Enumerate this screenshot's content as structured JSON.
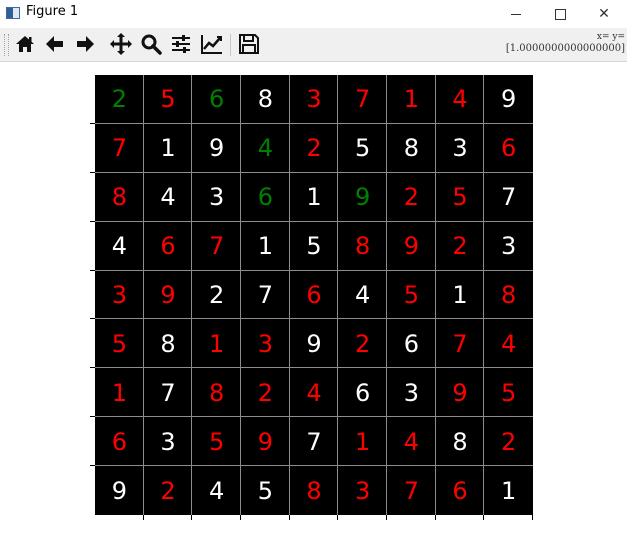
{
  "window": {
    "title": "Figure 1",
    "minimize_glyph": "",
    "maximize_glyph": "",
    "close_glyph": "✕"
  },
  "toolbar": {
    "buttons": [
      {
        "name": "home-button",
        "icon": "home-icon"
      },
      {
        "name": "back-button",
        "icon": "arrow-left-icon"
      },
      {
        "name": "forward-button",
        "icon": "arrow-right-icon"
      },
      {
        "name": "pan-button",
        "icon": "move-icon"
      },
      {
        "name": "zoom-button",
        "icon": "magnifier-icon"
      },
      {
        "name": "configure-subplots-button",
        "icon": "sliders-icon"
      },
      {
        "name": "edit-axes-button",
        "icon": "line-chart-icon"
      },
      {
        "name": "save-button",
        "icon": "floppy-disk-icon"
      }
    ],
    "coords_line1": "x= y=",
    "coords_line2": "[1.0000000000000000]"
  },
  "colors": {
    "board_background": "#000000",
    "grid": "#8c8c8c",
    "white": "#ffffff",
    "red": "#ff0000",
    "green": "#008000"
  },
  "board": {
    "rows": [
      [
        {
          "v": "2",
          "c": "green"
        },
        {
          "v": "5",
          "c": "red"
        },
        {
          "v": "6",
          "c": "green"
        },
        {
          "v": "8",
          "c": "white"
        },
        {
          "v": "3",
          "c": "red"
        },
        {
          "v": "7",
          "c": "red"
        },
        {
          "v": "1",
          "c": "red"
        },
        {
          "v": "4",
          "c": "red"
        },
        {
          "v": "9",
          "c": "white"
        }
      ],
      [
        {
          "v": "7",
          "c": "red"
        },
        {
          "v": "1",
          "c": "white"
        },
        {
          "v": "9",
          "c": "white"
        },
        {
          "v": "4",
          "c": "green"
        },
        {
          "v": "2",
          "c": "red"
        },
        {
          "v": "5",
          "c": "white"
        },
        {
          "v": "8",
          "c": "white"
        },
        {
          "v": "3",
          "c": "white"
        },
        {
          "v": "6",
          "c": "red"
        }
      ],
      [
        {
          "v": "8",
          "c": "red"
        },
        {
          "v": "4",
          "c": "white"
        },
        {
          "v": "3",
          "c": "white"
        },
        {
          "v": "6",
          "c": "green"
        },
        {
          "v": "1",
          "c": "white"
        },
        {
          "v": "9",
          "c": "green"
        },
        {
          "v": "2",
          "c": "red"
        },
        {
          "v": "5",
          "c": "red"
        },
        {
          "v": "7",
          "c": "white"
        }
      ],
      [
        {
          "v": "4",
          "c": "white"
        },
        {
          "v": "6",
          "c": "red"
        },
        {
          "v": "7",
          "c": "red"
        },
        {
          "v": "1",
          "c": "white"
        },
        {
          "v": "5",
          "c": "white"
        },
        {
          "v": "8",
          "c": "red"
        },
        {
          "v": "9",
          "c": "red"
        },
        {
          "v": "2",
          "c": "red"
        },
        {
          "v": "3",
          "c": "white"
        }
      ],
      [
        {
          "v": "3",
          "c": "red"
        },
        {
          "v": "9",
          "c": "red"
        },
        {
          "v": "2",
          "c": "white"
        },
        {
          "v": "7",
          "c": "white"
        },
        {
          "v": "6",
          "c": "red"
        },
        {
          "v": "4",
          "c": "white"
        },
        {
          "v": "5",
          "c": "red"
        },
        {
          "v": "1",
          "c": "white"
        },
        {
          "v": "8",
          "c": "red"
        }
      ],
      [
        {
          "v": "5",
          "c": "red"
        },
        {
          "v": "8",
          "c": "white"
        },
        {
          "v": "1",
          "c": "red"
        },
        {
          "v": "3",
          "c": "red"
        },
        {
          "v": "9",
          "c": "white"
        },
        {
          "v": "2",
          "c": "red"
        },
        {
          "v": "6",
          "c": "white"
        },
        {
          "v": "7",
          "c": "red"
        },
        {
          "v": "4",
          "c": "red"
        }
      ],
      [
        {
          "v": "1",
          "c": "red"
        },
        {
          "v": "7",
          "c": "white"
        },
        {
          "v": "8",
          "c": "red"
        },
        {
          "v": "2",
          "c": "red"
        },
        {
          "v": "4",
          "c": "red"
        },
        {
          "v": "6",
          "c": "white"
        },
        {
          "v": "3",
          "c": "white"
        },
        {
          "v": "9",
          "c": "red"
        },
        {
          "v": "5",
          "c": "red"
        }
      ],
      [
        {
          "v": "6",
          "c": "red"
        },
        {
          "v": "3",
          "c": "white"
        },
        {
          "v": "5",
          "c": "red"
        },
        {
          "v": "9",
          "c": "red"
        },
        {
          "v": "7",
          "c": "white"
        },
        {
          "v": "1",
          "c": "red"
        },
        {
          "v": "4",
          "c": "red"
        },
        {
          "v": "8",
          "c": "white"
        },
        {
          "v": "2",
          "c": "red"
        }
      ],
      [
        {
          "v": "9",
          "c": "white"
        },
        {
          "v": "2",
          "c": "red"
        },
        {
          "v": "4",
          "c": "white"
        },
        {
          "v": "5",
          "c": "white"
        },
        {
          "v": "8",
          "c": "red"
        },
        {
          "v": "3",
          "c": "red"
        },
        {
          "v": "7",
          "c": "red"
        },
        {
          "v": "6",
          "c": "red"
        },
        {
          "v": "1",
          "c": "white"
        }
      ]
    ]
  }
}
